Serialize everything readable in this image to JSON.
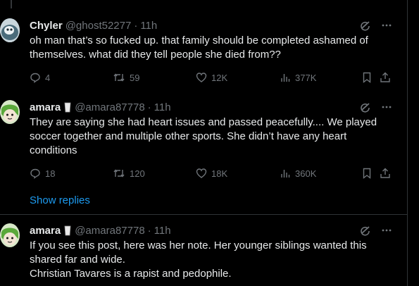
{
  "tweets": [
    {
      "name": "Chyler",
      "handle": "@ghost52277",
      "dot": "·",
      "time": "11h",
      "lines": [
        "oh man that’s so fucked up. that family should be completed ashamed of",
        "themselves. what did they tell people she died from??"
      ],
      "actions": {
        "replies": "4",
        "reposts": "59",
        "likes": "12K",
        "views": "377K"
      }
    },
    {
      "name": "amara",
      "badge_icon": "milk-glass-icon",
      "handle": "@amara87778",
      "dot": "·",
      "time": "11h",
      "lines": [
        "They are saying she had heart issues and passed peacefully.... We played",
        "soccer together and multiple other sports. She didn’t have any heart",
        "conditions"
      ],
      "actions": {
        "replies": "18",
        "reposts": "120",
        "likes": "18K",
        "views": "360K"
      }
    },
    {
      "name": "amara",
      "badge_icon": "milk-glass-icon",
      "handle": "@amara87778",
      "dot": "·",
      "time": "11h",
      "lines": [
        "If you see this post, here was her note. Her younger siblings wanted this",
        "shared far and wide.",
        "Christian Tavares is a rapist and pedophile."
      ]
    }
  ],
  "show_replies": "Show replies",
  "colors": {
    "background": "#000000",
    "text": "#e7e9ea",
    "muted": "#71767b",
    "link": "#1d9bf0",
    "border": "#2f3336"
  }
}
